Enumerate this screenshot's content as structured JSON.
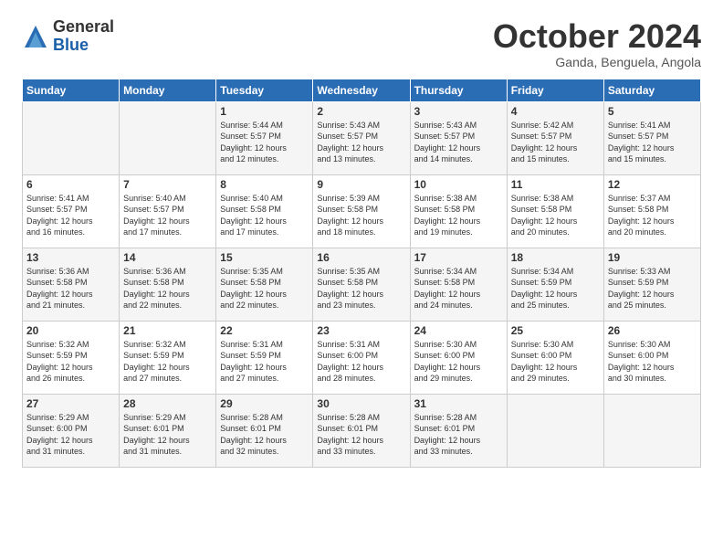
{
  "logo": {
    "general": "General",
    "blue": "Blue"
  },
  "title": "October 2024",
  "subtitle": "Ganda, Benguela, Angola",
  "days_of_week": [
    "Sunday",
    "Monday",
    "Tuesday",
    "Wednesday",
    "Thursday",
    "Friday",
    "Saturday"
  ],
  "weeks": [
    [
      {
        "day": "",
        "info": ""
      },
      {
        "day": "",
        "info": ""
      },
      {
        "day": "1",
        "info": "Sunrise: 5:44 AM\nSunset: 5:57 PM\nDaylight: 12 hours\nand 12 minutes."
      },
      {
        "day": "2",
        "info": "Sunrise: 5:43 AM\nSunset: 5:57 PM\nDaylight: 12 hours\nand 13 minutes."
      },
      {
        "day": "3",
        "info": "Sunrise: 5:43 AM\nSunset: 5:57 PM\nDaylight: 12 hours\nand 14 minutes."
      },
      {
        "day": "4",
        "info": "Sunrise: 5:42 AM\nSunset: 5:57 PM\nDaylight: 12 hours\nand 15 minutes."
      },
      {
        "day": "5",
        "info": "Sunrise: 5:41 AM\nSunset: 5:57 PM\nDaylight: 12 hours\nand 15 minutes."
      }
    ],
    [
      {
        "day": "6",
        "info": "Sunrise: 5:41 AM\nSunset: 5:57 PM\nDaylight: 12 hours\nand 16 minutes."
      },
      {
        "day": "7",
        "info": "Sunrise: 5:40 AM\nSunset: 5:57 PM\nDaylight: 12 hours\nand 17 minutes."
      },
      {
        "day": "8",
        "info": "Sunrise: 5:40 AM\nSunset: 5:58 PM\nDaylight: 12 hours\nand 17 minutes."
      },
      {
        "day": "9",
        "info": "Sunrise: 5:39 AM\nSunset: 5:58 PM\nDaylight: 12 hours\nand 18 minutes."
      },
      {
        "day": "10",
        "info": "Sunrise: 5:38 AM\nSunset: 5:58 PM\nDaylight: 12 hours\nand 19 minutes."
      },
      {
        "day": "11",
        "info": "Sunrise: 5:38 AM\nSunset: 5:58 PM\nDaylight: 12 hours\nand 20 minutes."
      },
      {
        "day": "12",
        "info": "Sunrise: 5:37 AM\nSunset: 5:58 PM\nDaylight: 12 hours\nand 20 minutes."
      }
    ],
    [
      {
        "day": "13",
        "info": "Sunrise: 5:36 AM\nSunset: 5:58 PM\nDaylight: 12 hours\nand 21 minutes."
      },
      {
        "day": "14",
        "info": "Sunrise: 5:36 AM\nSunset: 5:58 PM\nDaylight: 12 hours\nand 22 minutes."
      },
      {
        "day": "15",
        "info": "Sunrise: 5:35 AM\nSunset: 5:58 PM\nDaylight: 12 hours\nand 22 minutes."
      },
      {
        "day": "16",
        "info": "Sunrise: 5:35 AM\nSunset: 5:58 PM\nDaylight: 12 hours\nand 23 minutes."
      },
      {
        "day": "17",
        "info": "Sunrise: 5:34 AM\nSunset: 5:58 PM\nDaylight: 12 hours\nand 24 minutes."
      },
      {
        "day": "18",
        "info": "Sunrise: 5:34 AM\nSunset: 5:59 PM\nDaylight: 12 hours\nand 25 minutes."
      },
      {
        "day": "19",
        "info": "Sunrise: 5:33 AM\nSunset: 5:59 PM\nDaylight: 12 hours\nand 25 minutes."
      }
    ],
    [
      {
        "day": "20",
        "info": "Sunrise: 5:32 AM\nSunset: 5:59 PM\nDaylight: 12 hours\nand 26 minutes."
      },
      {
        "day": "21",
        "info": "Sunrise: 5:32 AM\nSunset: 5:59 PM\nDaylight: 12 hours\nand 27 minutes."
      },
      {
        "day": "22",
        "info": "Sunrise: 5:31 AM\nSunset: 5:59 PM\nDaylight: 12 hours\nand 27 minutes."
      },
      {
        "day": "23",
        "info": "Sunrise: 5:31 AM\nSunset: 6:00 PM\nDaylight: 12 hours\nand 28 minutes."
      },
      {
        "day": "24",
        "info": "Sunrise: 5:30 AM\nSunset: 6:00 PM\nDaylight: 12 hours\nand 29 minutes."
      },
      {
        "day": "25",
        "info": "Sunrise: 5:30 AM\nSunset: 6:00 PM\nDaylight: 12 hours\nand 29 minutes."
      },
      {
        "day": "26",
        "info": "Sunrise: 5:30 AM\nSunset: 6:00 PM\nDaylight: 12 hours\nand 30 minutes."
      }
    ],
    [
      {
        "day": "27",
        "info": "Sunrise: 5:29 AM\nSunset: 6:00 PM\nDaylight: 12 hours\nand 31 minutes."
      },
      {
        "day": "28",
        "info": "Sunrise: 5:29 AM\nSunset: 6:01 PM\nDaylight: 12 hours\nand 31 minutes."
      },
      {
        "day": "29",
        "info": "Sunrise: 5:28 AM\nSunset: 6:01 PM\nDaylight: 12 hours\nand 32 minutes."
      },
      {
        "day": "30",
        "info": "Sunrise: 5:28 AM\nSunset: 6:01 PM\nDaylight: 12 hours\nand 33 minutes."
      },
      {
        "day": "31",
        "info": "Sunrise: 5:28 AM\nSunset: 6:01 PM\nDaylight: 12 hours\nand 33 minutes."
      },
      {
        "day": "",
        "info": ""
      },
      {
        "day": "",
        "info": ""
      }
    ]
  ]
}
